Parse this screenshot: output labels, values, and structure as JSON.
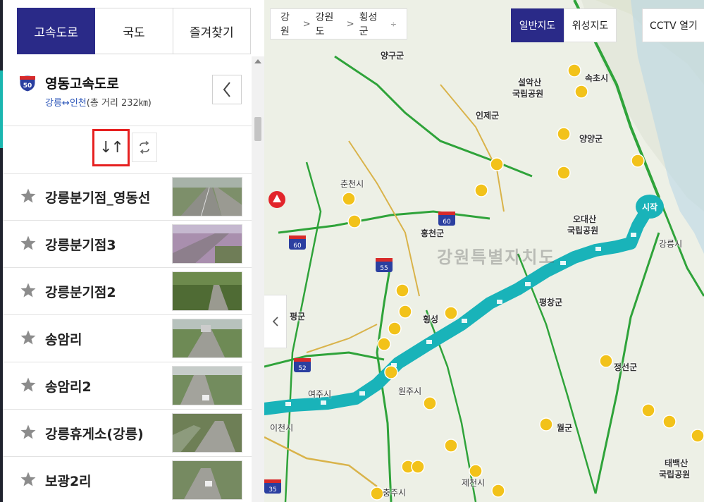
{
  "tabs": [
    {
      "label": "고속도로",
      "active": true
    },
    {
      "label": "국도",
      "active": false
    },
    {
      "label": "즐겨찾기",
      "active": false
    }
  ],
  "road": {
    "shield_number": "50",
    "name": "영동고속도로",
    "route_start": "강릉",
    "route_arrow": "↔",
    "route_end": "인천",
    "distance": "(총 거리 232㎞)"
  },
  "cctv_list": [
    "강릉분기점_영동선",
    "강릉분기점3",
    "강릉분기점2",
    "송암리",
    "송암리2",
    "강릉휴게소(강릉)",
    "보광2리"
  ],
  "breadcrumb": {
    "level1": "강원",
    "level2": "강원도",
    "level3": "횡성군",
    "sep": ">",
    "more": "÷"
  },
  "map_type": {
    "normal": "일반지도",
    "satellite": "위성지도"
  },
  "cctv_toggle": "CCTV 열기",
  "map": {
    "region_name": "강원특별자치도",
    "start_label": "시작",
    "labels": [
      {
        "text": "양구군"
      },
      {
        "text": "속초시"
      },
      {
        "text": "설악산"
      },
      {
        "text": "국립공원"
      },
      {
        "text": "인제군"
      },
      {
        "text": "양양군"
      },
      {
        "text": "춘천시"
      },
      {
        "text": "홍천군"
      },
      {
        "text": "오대산"
      },
      {
        "text": "국립공원"
      },
      {
        "text": "강릉시"
      },
      {
        "text": "평창군"
      },
      {
        "text": "횡성"
      },
      {
        "text": "원주시"
      },
      {
        "text": "정선군"
      },
      {
        "text": "이천시"
      },
      {
        "text": "여주시"
      },
      {
        "text": "충주시"
      },
      {
        "text": "제천시"
      },
      {
        "text": "태백산"
      },
      {
        "text": "국립공원"
      },
      {
        "text": "평군"
      },
      {
        "text": "월군"
      }
    ],
    "route_shields": [
      "60",
      "60",
      "55",
      "52",
      "35"
    ]
  },
  "colors": {
    "accent": "#2a2a88",
    "route": "#19b3b9",
    "highlight": "#e62020",
    "teal_strip": "#1bb6b0"
  }
}
